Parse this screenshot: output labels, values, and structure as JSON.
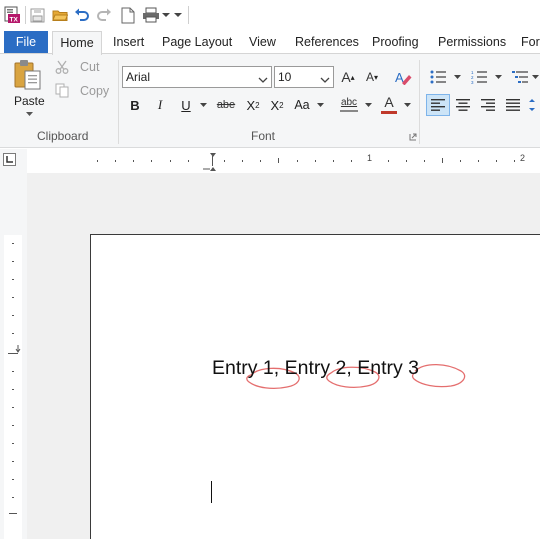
{
  "quick_access": {
    "icons": [
      "app-logo-icon",
      "save-icon",
      "open-folder-icon",
      "undo-icon",
      "redo-icon",
      "new-document-icon",
      "print-icon",
      "customize-dropdown-icon"
    ]
  },
  "tabs": [
    {
      "label": "File"
    },
    {
      "label": "Home"
    },
    {
      "label": "Insert"
    },
    {
      "label": "Page Layout"
    },
    {
      "label": "View"
    },
    {
      "label": "References"
    },
    {
      "label": "Proofing"
    },
    {
      "label": "Permissions"
    },
    {
      "label": "Forr"
    }
  ],
  "clipboard": {
    "paste_label": "Paste",
    "cut_label": "Cut",
    "copy_label": "Copy",
    "group_label": "Clipboard"
  },
  "font": {
    "font_name": "Arial",
    "font_size": "10",
    "group_label": "Font",
    "bold_label": "B",
    "italic_label": "I",
    "underline_label": "U",
    "strike_label": "abe",
    "subscript_label": "X",
    "subscript_sub": "2",
    "superscript_label": "X",
    "superscript_sup": "2",
    "case_label": "Aa",
    "grow_label": "A",
    "shrink_label": "A",
    "spell_label": "abc",
    "font_color_label": "A",
    "font_color": "#c0392b"
  },
  "ruler": {
    "h_numbers": [
      "1",
      "2"
    ]
  },
  "document": {
    "text": "Entry 1, Entry 2, Entry 3"
  },
  "colors": {
    "accent": "#2b6dc4",
    "selected_tool": "#cce4f7",
    "annotation": "#e05555"
  }
}
